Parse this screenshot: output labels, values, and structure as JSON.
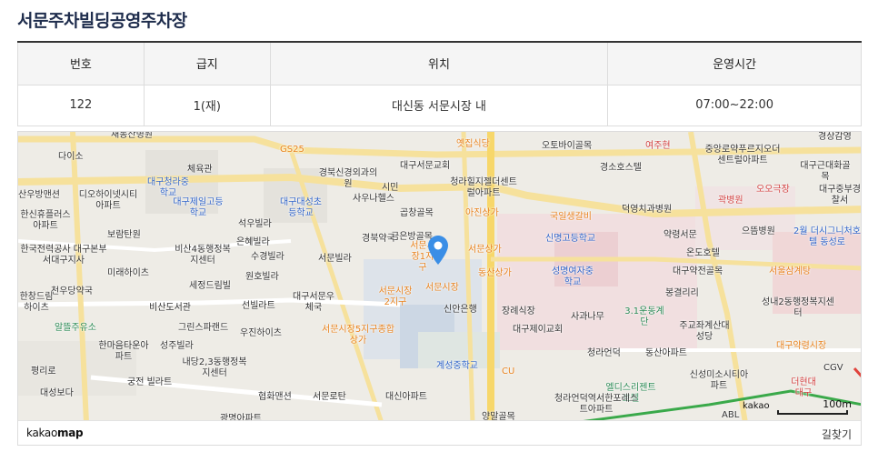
{
  "page": {
    "title": "서문주차빌딩공영주차장"
  },
  "table": {
    "headers": [
      "번호",
      "급지",
      "위치",
      "운영시간"
    ],
    "row": [
      "122",
      "1(재)",
      "대신동 서문시장 내",
      "07:00~22:00"
    ]
  },
  "map": {
    "brand_prefix": "kakao",
    "brand_suffix": "map",
    "route_label": "길찾기",
    "scale_brand": "kakao",
    "scale_label": "100m",
    "labels": [
      "새동산병원",
      "다이소",
      "체육관",
      "GS25",
      "경북신경외과의원",
      "옛집식당",
      "오토바이골목",
      "여주현",
      "중앙로약푸르지오더센트럴아파트",
      "경상감영",
      "대구청라중학교",
      "대구서문교회",
      "청라힐지젤더센트럴아파트",
      "경소호스텔",
      "대구근대화골목",
      "산우방맨션",
      "디오하이넷시티아파트",
      "대구제일고등학교",
      "대구대성초등학교",
      "시민",
      "사우나헬스",
      "곱창골목",
      "아진상가",
      "국일생갈비",
      "덕영치과병원",
      "곽병원",
      "오오극장",
      "대구중부경찰서",
      "한신휴플러스아파트",
      "석우빌라",
      "금은방골목",
      "으뜸병원",
      "보람탄원",
      "은혜빌라",
      "경북약국",
      "서문시장1지구",
      "신명고등학교",
      "약령서문",
      "2월 더시그니처호텔 동성로",
      "한국전력공사 대구본부 서대구지사",
      "비산4동행정복지센터",
      "수경빌라",
      "서문빌라",
      "서문상가",
      "동산상가",
      "온도호텔",
      "미래하이츠",
      "원호빌라",
      "성명여자중학교",
      "대구약전골목",
      "서울삼계탕",
      "천우당약국",
      "세정드림빌",
      "서문시장2지구",
      "서문시장",
      "봉결리리",
      "성내2동행정복지센터",
      "한창드림하이츠",
      "비산도서관",
      "선빌라트",
      "대구서문우체국",
      "신안은행",
      "장례식장",
      "사과나무",
      "3.1운동계단",
      "주교좌계산대성당",
      "알뜰주유소",
      "그린스파랜드",
      "우진하이츠",
      "서문시장5지구종합상가",
      "대구제이교회",
      "한마음타운아파트",
      "성주빌라",
      "청라언덕",
      "동산아파트",
      "대구약령시장",
      "내당2,3동행정복지센터",
      "계성중학교",
      "CGV",
      "평리로",
      "궁전 빌라트",
      "CU",
      "엘디스리젠트호텔",
      "신성미소시티아파트",
      "더현대대구",
      "대성보다",
      "협화맨션",
      "서문로탄",
      "대신아파트",
      "청라언덕역서한포레스트아파트",
      "광명아파트",
      "양말골목",
      "ABL"
    ]
  }
}
